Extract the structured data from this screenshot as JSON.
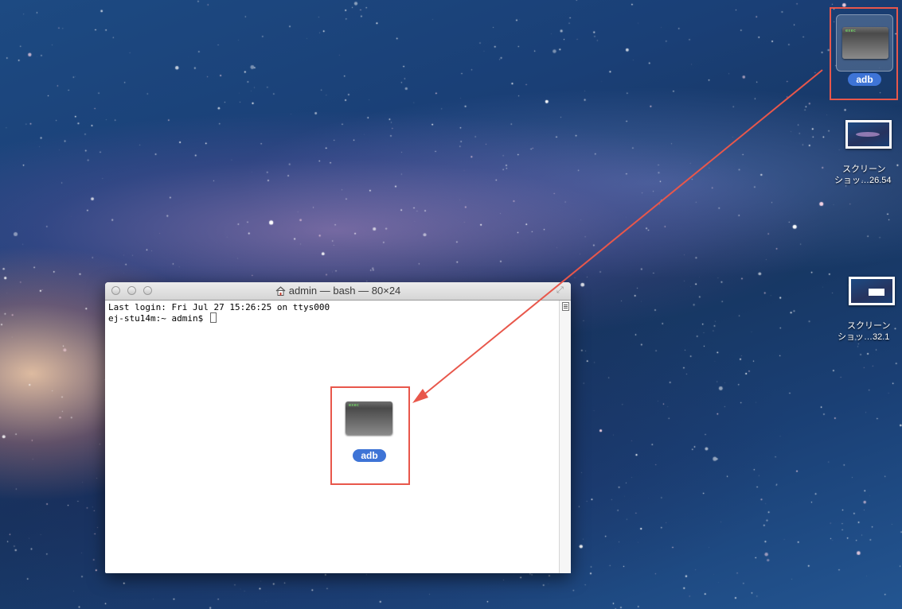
{
  "desktop": {
    "icons": [
      {
        "label": "adb",
        "thumb_text": "exec",
        "selected": true
      },
      {
        "label_lines": [
          "スクリーン",
          "ショッ…26.54"
        ]
      },
      {
        "label_lines": [
          "スクリーン",
          "ショッ…32.1"
        ]
      }
    ]
  },
  "terminal_window": {
    "title": "admin — bash — 80×24",
    "lines": [
      "Last login: Fri Jul 27 15:26:25 on ttys000",
      "ej-stu14m:~ admin$ "
    ],
    "dragged_icon": {
      "label": "adb",
      "thumb_text": "exec"
    }
  },
  "annotation": {
    "color": "#e8574b"
  }
}
